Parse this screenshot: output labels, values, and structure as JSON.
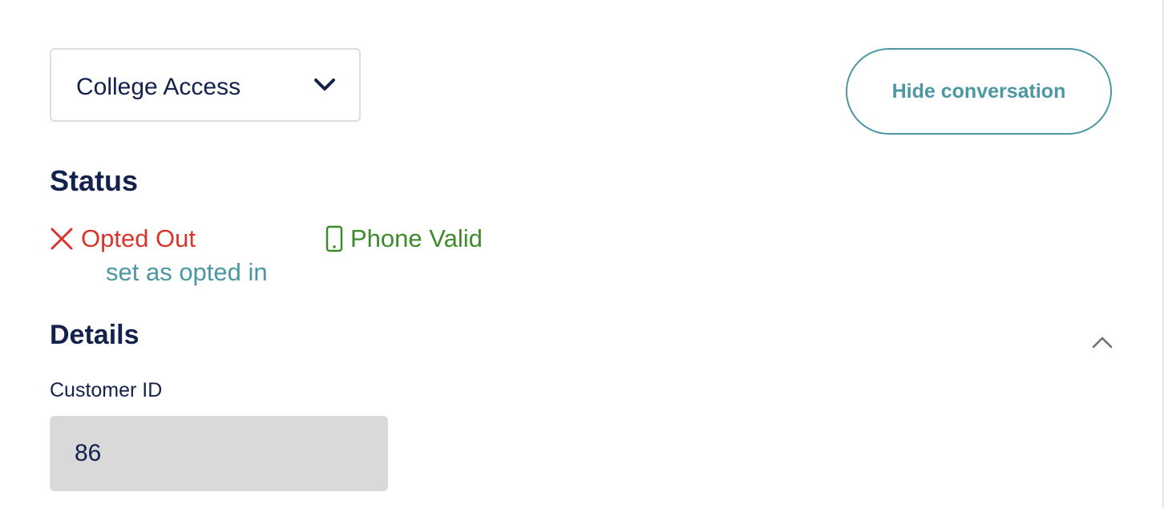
{
  "program_select": {
    "selected": "College Access"
  },
  "hide_conversation_button": {
    "label": "Hide conversation"
  },
  "status": {
    "title": "Status",
    "opt_status": {
      "label": "Opted Out",
      "color": "#d9342b",
      "icon": "x-icon"
    },
    "opt_action": {
      "label": "set as opted in",
      "color": "#4b97a2"
    },
    "phone_status": {
      "label": "Phone Valid",
      "color": "#3f8a2a",
      "icon": "phone-icon"
    }
  },
  "details": {
    "title": "Details",
    "collapse_icon": "chevron-up-icon",
    "customer_id": {
      "label": "Customer ID",
      "value": "86"
    }
  },
  "colors": {
    "navy": "#13224c",
    "teal": "#4b97a2"
  }
}
